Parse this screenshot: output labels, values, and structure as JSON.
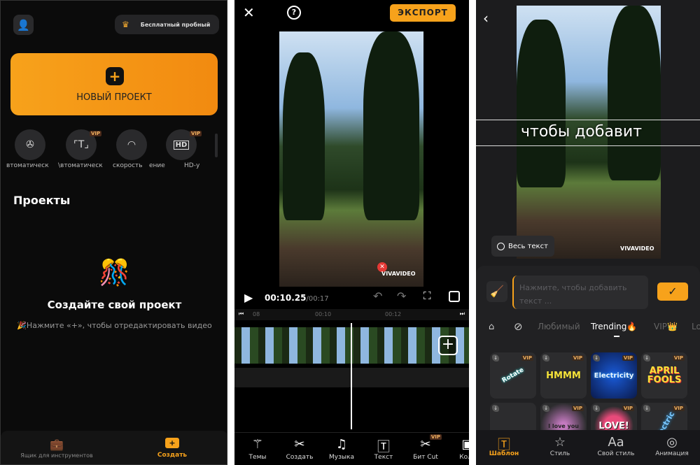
{
  "home": {
    "trial_label": "Бесплатный пробный",
    "new_project_label": "НОВЫЙ ПРОЕКТ",
    "tools": [
      {
        "label": "втоматическ",
        "icon": "film-reel-icon",
        "vip": false
      },
      {
        "label": "\\втоматическ",
        "icon": "text-scan-icon",
        "vip": true
      },
      {
        "label": "скорость",
        "icon": "speedometer-icon",
        "vip": false
      },
      {
        "label": "ение",
        "icon": "",
        "vip": false
      },
      {
        "label": "HD-у",
        "icon": "hd-icon",
        "vip": true
      }
    ],
    "vip_badge": "VIP",
    "projects_title": "Проекты",
    "empty_title": "Создайте свой проект",
    "empty_hint": "🎉Нажмите «+», чтобы отредактировать видео",
    "nav": [
      {
        "label": "Ящик для инструментов",
        "icon": "toolbox-icon",
        "active": false
      },
      {
        "label": "Создать",
        "icon": "video-plus-icon",
        "active": true
      }
    ],
    "accent": "#f7a21b"
  },
  "editor": {
    "export_label": "ЭКСПОРТ",
    "watermark": "VIVAVIDEO",
    "current_time": "00:10.25",
    "total_time": "/00:17",
    "ruler": [
      "08",
      "00:10",
      "00:12"
    ],
    "tools": [
      {
        "label": "Темы",
        "icon": "magic-wand-icon"
      },
      {
        "label": "Создать",
        "icon": "scissors-icon"
      },
      {
        "label": "Музыка",
        "icon": "music-note-icon"
      },
      {
        "label": "Текст",
        "icon": "text-box-icon"
      },
      {
        "label": "Бит Cut",
        "icon": "beat-cut-icon",
        "vip": true
      },
      {
        "label": "Колл",
        "icon": "collage-icon"
      }
    ]
  },
  "text_editor": {
    "overlay_text": "чтобы добавит",
    "watermark": "VIVAVIDEO",
    "all_text_label": "Весь текст",
    "input_placeholder": "Нажмите, чтобы добавить текст ...",
    "tabs": [
      {
        "label": "Любимый",
        "active": false
      },
      {
        "label": "Trending🔥",
        "active": true
      },
      {
        "label": "VIP👑",
        "active": false
      },
      {
        "label": "Lo",
        "active": false
      }
    ],
    "templates": [
      "Rotate",
      "HMMM",
      "Electricity",
      "APRIL FOOLS",
      "",
      "I love you",
      "LOVE!",
      "Electric"
    ],
    "nav": [
      {
        "label": "Шаблон",
        "icon": "template-icon",
        "active": true
      },
      {
        "label": "Стиль",
        "icon": "star-icon",
        "active": false
      },
      {
        "label": "Свой стиль",
        "icon": "font-icon",
        "active": false
      },
      {
        "label": "Анимация",
        "icon": "animation-icon",
        "active": false
      }
    ]
  }
}
